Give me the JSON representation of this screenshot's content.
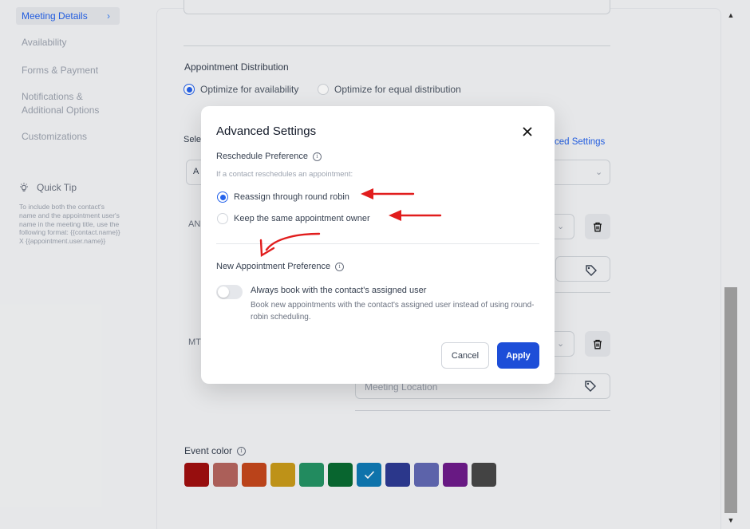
{
  "sidebar": {
    "items": [
      {
        "label": "Meeting Details",
        "active": true
      },
      {
        "label": "Availability"
      },
      {
        "label": "Forms & Payment"
      },
      {
        "label": "Notifications &"
      },
      {
        "label": "Additional Options"
      },
      {
        "label": "Customizations"
      }
    ],
    "tip": {
      "title": "Quick Tip",
      "icon": "lightbulb-icon",
      "body": "To include both the contact's name and the appointment user's name in the meeting title, use the following format: {{contact.name}} X {{appointment.user.name}}"
    }
  },
  "main": {
    "distribution": {
      "title": "Appointment Distribution",
      "options": [
        "Optimize for availability",
        "Optimize for equal distribution"
      ],
      "selected": "Optimize for availability"
    },
    "select_label_partial": "Sele",
    "advanced_link_partial": "ced Settings",
    "select_value_partial": "A",
    "row_prefix_1": "AN",
    "row_prefix_2": "MT",
    "meeting_location_placeholder": "Meeting Location",
    "event_color": {
      "title": "Event color",
      "colors": [
        "#a00f0f",
        "#b5655e",
        "#c4471c",
        "#c99a1a",
        "#249365",
        "#096b32",
        "#0f7ab5",
        "#2e3a93",
        "#6169b4",
        "#6e1b8b",
        "#474747"
      ],
      "selected_index": 6
    }
  },
  "modal": {
    "title": "Advanced Settings",
    "reschedule": {
      "label": "Reschedule Preference",
      "hint": "If a contact reschedules an appointment:",
      "options": [
        "Reassign through round robin",
        "Keep the same appointment owner"
      ],
      "selected": "Reassign through round robin"
    },
    "new_appointment": {
      "label": "New Appointment Preference",
      "toggle_title": "Always book with the contact's assigned user",
      "toggle_desc": "Book new appointments with the contact's assigned user instead of using round-robin scheduling.",
      "toggle_on": false
    },
    "cancel_label": "Cancel",
    "apply_label": "Apply"
  },
  "colors": {
    "accent": "#2563eb",
    "annotation": "#e11d1d"
  }
}
